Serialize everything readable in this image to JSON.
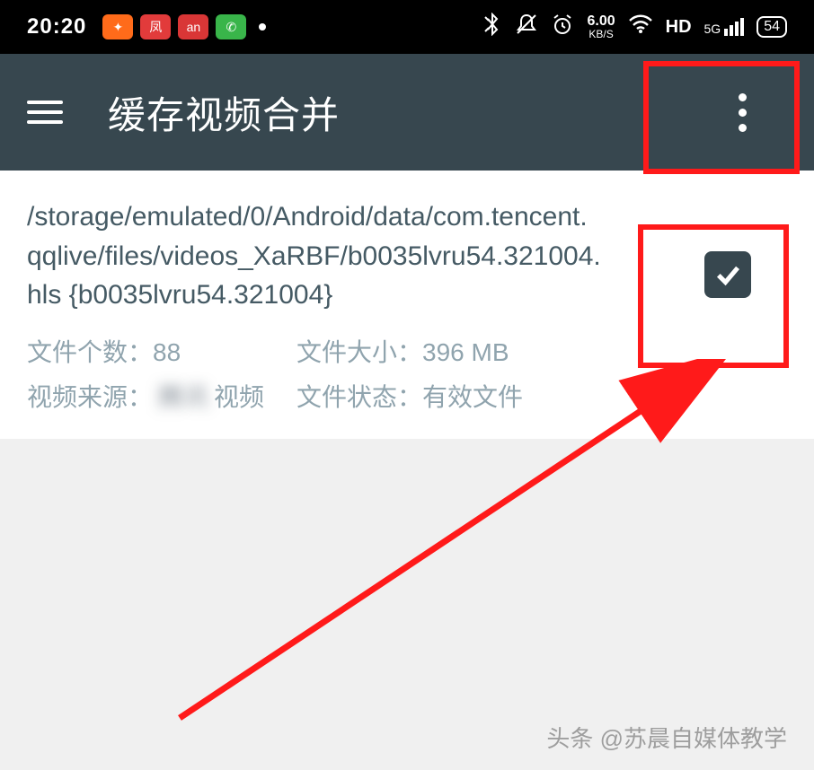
{
  "statusbar": {
    "time": "20:20",
    "kb_top": "6.00",
    "kb_bottom": "KB/S",
    "hd": "HD",
    "fiveg": "5G",
    "battery": "54"
  },
  "appbar": {
    "title": "缓存视频合并"
  },
  "card": {
    "path": "/storage/emulated/0/Android/data/com.tencent.qqlive/files/videos_XaRBF/b0035lvru54.321004.hls  {b0035lvru54.321004}",
    "file_count_label": "文件个数：",
    "file_count_value": "88",
    "file_size_label": "文件大小：",
    "file_size_value": "396 MB",
    "source_label": "视频来源：",
    "source_value_blurred": "腾讯",
    "source_suffix": "视频",
    "status_label": "文件状态：",
    "status_value": "有效文件",
    "checked": true
  },
  "watermark": "头条 @苏晨自媒体教学"
}
